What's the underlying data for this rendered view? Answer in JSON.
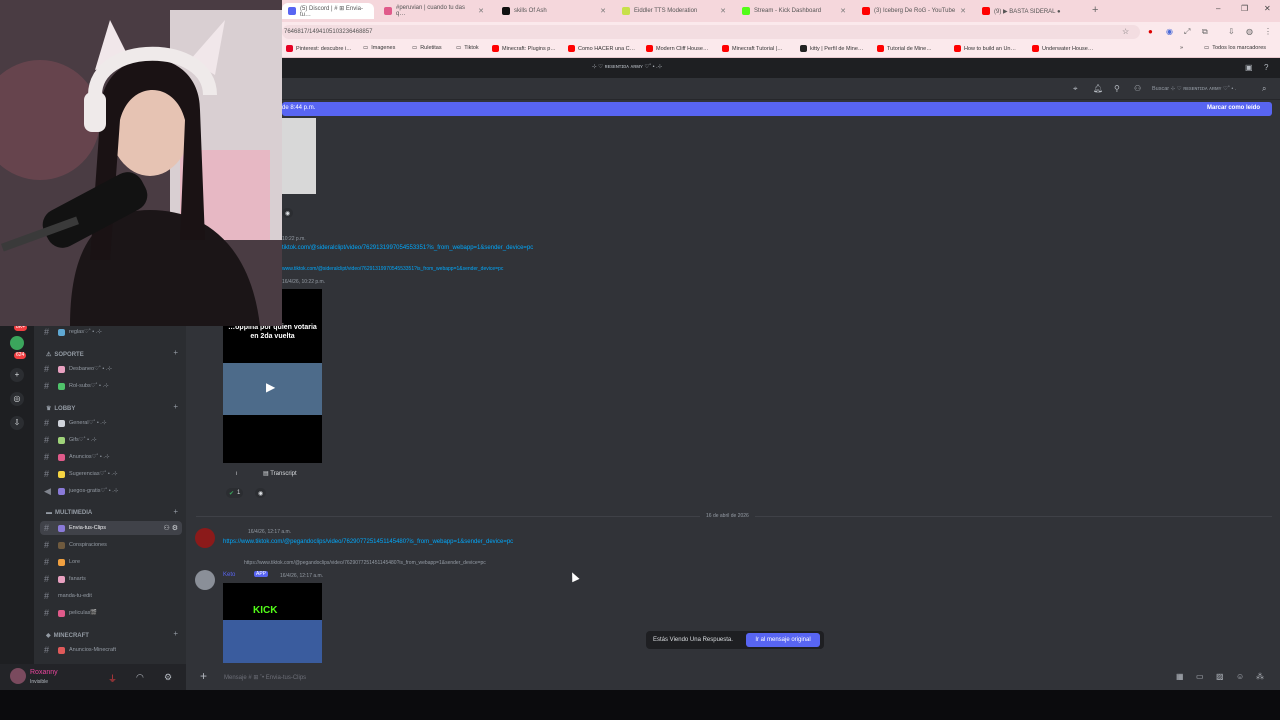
{
  "browser": {
    "tabs": [
      {
        "label": "(5) Discord | # ⊞ Envia-tu…",
        "color": "#5865f2",
        "active": true
      },
      {
        "label": "#peruvian | cuando tu das q…",
        "color": "#e05a8a"
      },
      {
        "label": "skills Of Ash",
        "color": "#111111"
      },
      {
        "label": "Eiddler TTS Moderation",
        "color": "#c7e04a"
      },
      {
        "label": "Stream - Kick Dashboard",
        "color": "#53fc18"
      },
      {
        "label": "(3) Iceberg De RoG - YouTube",
        "color": "#ff0000"
      },
      {
        "label": "(9) ▶ BASTA SIDERAL ●",
        "color": "#ff0000"
      }
    ],
    "new_tab": "+",
    "window_controls": [
      "–",
      "❐",
      "✕"
    ],
    "url": "7646817/1494105103236468857",
    "bookmarks": [
      {
        "label": "Pinterest: descubre i…",
        "color": "#e60023"
      },
      {
        "label": "Imagenes",
        "color": "#555555"
      },
      {
        "label": "Ruletitas",
        "color": "#555555"
      },
      {
        "label": "Tiktok",
        "color": "#555555"
      },
      {
        "label": "Minecraft: Plugins p…",
        "color": "#ff0000"
      },
      {
        "label": "Como HACER una C…",
        "color": "#ff0000"
      },
      {
        "label": "Modern Cliff House…",
        "color": "#ff0000"
      },
      {
        "label": "Minecraft Tutorial |…",
        "color": "#ff0000"
      },
      {
        "label": "kitty | Perfil de Mine…",
        "color": "#222222"
      },
      {
        "label": "Tutorial de Mine…",
        "color": "#ff0000"
      },
      {
        "label": "How to build an Un…",
        "color": "#ff0000"
      },
      {
        "label": "Underwater House…",
        "color": "#ff0000"
      }
    ],
    "all_bookmarks": "Todos los marcadores"
  },
  "discord": {
    "window_title": "⊹ ♡ ʀᴇsᴇɴᴛɪᴅᴀ ᴀʀᴍʏ ♡˚ • .⊹",
    "search_placeholder": "Buscar ⊹ ♡ ʀᴇsᴇɴᴛɪᴅᴀ ᴀʀᴍʏ ♡˚ • .",
    "new_messages_since": "de 8:44 p.m.",
    "mark_as_read": "Marcar como leído",
    "guild_badges": [
      "8K+",
      "624"
    ],
    "categories": [
      {
        "name": "SOPORTE",
        "channels": [
          "Desbaneo♡˚ • .⊹",
          "Rol-subs♡˚ • .⊹"
        ]
      },
      {
        "name": "LOBBY",
        "channels": [
          "General♡˚ • .⊹",
          "Gifs♡˚ • .⊹",
          "Anuncios♡˚ • .⊹",
          "Sugerencias♡˚ • .⊹",
          "juegos-gratis♡˚ • .⊹"
        ]
      },
      {
        "name": "MULTIMEDIA",
        "channels": [
          "Envia-tus-Clips",
          "Conspiraciones",
          "Lore",
          "fanarts",
          "manda-tu-edit",
          "peliculas🎬"
        ]
      },
      {
        "name": "MINECRAFT",
        "channels": [
          "Anuncios-Minecraft"
        ]
      }
    ],
    "top_channel": "reglas♡˚ • .⊹",
    "user": {
      "name": "Roxanny",
      "status": "Invisible"
    },
    "messages": {
      "m1_time": "10:22 p.m.",
      "m1_link": "tiktok.com/@sideralclipt/video/7629131997054553351?is_from_webapp=1&sender_device=pc",
      "m2_reply_link": "www.tiktok.com/@sideralclipt/video/7629131997054553351?is_from_webapp=1&sender_device=pc",
      "m2_date": "16/4/26, 10:22 p.m.",
      "video_caption": "…oppina por quien votaria en 2da vuelta",
      "transcript": "Transcript",
      "reaction_count": "1",
      "date_divider": "16 de abril de 2026",
      "m3_time": "16/4/26, 12:17 a.m.",
      "m3_link": "https://www.tiktok.com/@pegandoclips/video/7629077251451145480?is_from_webapp=1&sender_device=pc",
      "m4_reply_link": "https://www.tiktok.com/@pegandoclips/video/7629077251451145480?is_from_webapp=1&sender_device=pc",
      "m4_author": "Keto",
      "m4_app_tag": "APP",
      "m4_time": "16/4/26, 12:17 a.m.",
      "kick_label": "KICK"
    },
    "reply_toast": {
      "text": "Estás Viendo Una Respuesta.",
      "button": "Ir al mensaje original"
    },
    "composer_placeholder": "Mensaje # ⊞ ˚• Envia-tus-Clips"
  }
}
